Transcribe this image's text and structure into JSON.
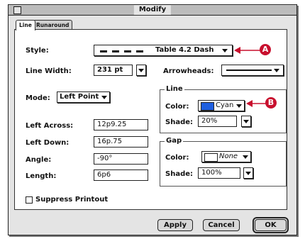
{
  "window": {
    "title": "Modify"
  },
  "tabs": [
    {
      "label": "Line"
    },
    {
      "label": "Runaround"
    }
  ],
  "style": {
    "label": "Style:",
    "value": "Table 4.2 Dash"
  },
  "line_width": {
    "label": "Line Width:",
    "value": "231  pt"
  },
  "arrowheads": {
    "label": "Arrowheads:"
  },
  "mode": {
    "label": "Mode:",
    "value": "Left Point"
  },
  "fields": {
    "left_across": {
      "label": "Left Across:",
      "value": "12p9.25"
    },
    "left_down": {
      "label": "Left Down:",
      "value": "16p.75"
    },
    "angle": {
      "label": "Angle:",
      "value": "-90°"
    },
    "length": {
      "label": "Length:",
      "value": "6p6"
    }
  },
  "line_group": {
    "title": "Line",
    "color_label": "Color:",
    "color_value": "Cyan",
    "color_swatch": "#1f5fe0",
    "shade_label": "Shade:",
    "shade_value": "20%"
  },
  "gap_group": {
    "title": "Gap",
    "color_label": "Color:",
    "color_value": "None",
    "shade_label": "Shade:",
    "shade_value": "100%"
  },
  "suppress": {
    "label": "Suppress Printout",
    "checked": false
  },
  "buttons": {
    "apply": "Apply",
    "cancel": "Cancel",
    "ok": "OK"
  },
  "callouts": {
    "a": "A",
    "b": "B",
    "color": "#c8102e"
  }
}
